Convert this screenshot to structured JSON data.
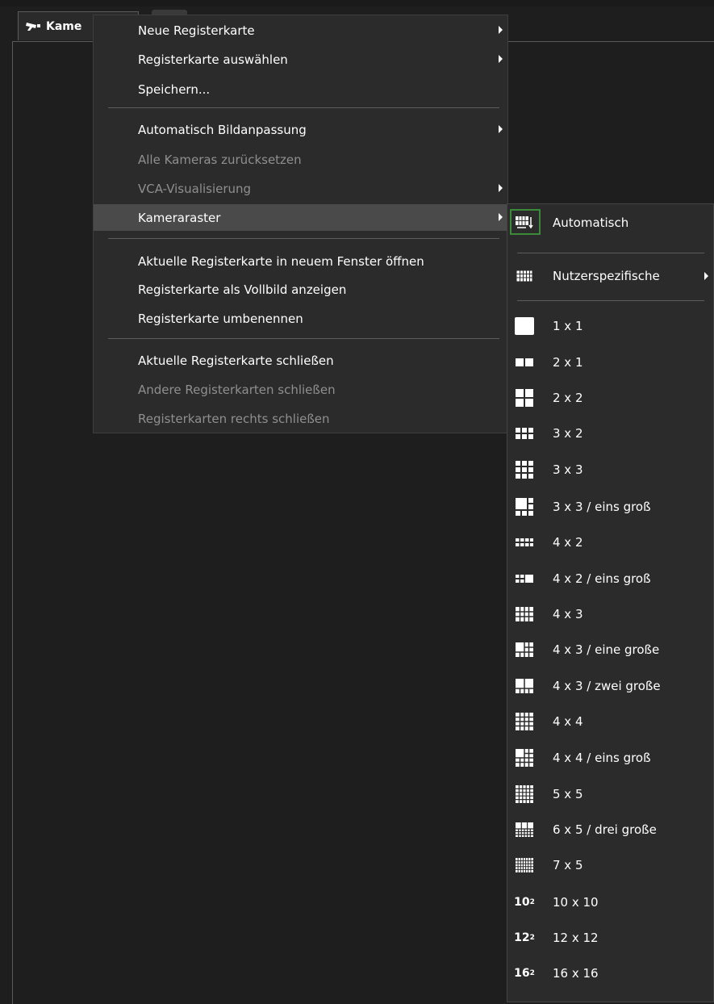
{
  "tab": {
    "label": "Kame"
  },
  "menu": {
    "items": [
      {
        "label": "Neue Registerkarte",
        "submenu": true,
        "disabled": false
      },
      {
        "label": "Registerkarte auswählen",
        "submenu": true,
        "disabled": false
      },
      {
        "label": "Speichern...",
        "submenu": false,
        "disabled": false
      },
      {
        "label": "Automatisch Bildanpassung",
        "submenu": true,
        "disabled": false
      },
      {
        "label": "Alle Kameras zurücksetzen",
        "submenu": false,
        "disabled": true
      },
      {
        "label": "VCA-Visualisierung",
        "submenu": true,
        "disabled": true
      },
      {
        "label": "Kameraraster",
        "submenu": true,
        "disabled": false,
        "highlighted": true
      },
      {
        "label": "Aktuelle Registerkarte in neuem Fenster öffnen",
        "submenu": false,
        "disabled": false
      },
      {
        "label": "Registerkarte als Vollbild anzeigen",
        "submenu": false,
        "disabled": false
      },
      {
        "label": "Registerkarte umbenennen",
        "submenu": false,
        "disabled": false
      },
      {
        "label": "Aktuelle Registerkarte schließen",
        "submenu": false,
        "disabled": false
      },
      {
        "label": "Andere Registerkarten schließen",
        "submenu": false,
        "disabled": true
      },
      {
        "label": "Registerkarten rechts schließen",
        "submenu": false,
        "disabled": true
      }
    ]
  },
  "submenu": {
    "automatic": {
      "label": "Automatisch",
      "icon": "auto-grid-icon"
    },
    "custom": {
      "label": "Nutzerspezifische",
      "icon": "custom-grid-icon"
    },
    "layouts": [
      {
        "label": "1 x 1",
        "icon": "grid-1x1-icon"
      },
      {
        "label": "2 x 1",
        "icon": "grid-2x1-icon"
      },
      {
        "label": "2 x 2",
        "icon": "grid-2x2-icon"
      },
      {
        "label": "3 x 2",
        "icon": "grid-3x2-icon"
      },
      {
        "label": "3 x 3",
        "icon": "grid-3x3-icon"
      },
      {
        "label": "3 x 3 / eins groß",
        "icon": "grid-3x3-one-large-icon"
      },
      {
        "label": "4 x 2",
        "icon": "grid-4x2-icon"
      },
      {
        "label": "4 x 2 / eins groß",
        "icon": "grid-4x2-one-large-icon"
      },
      {
        "label": "4 x 3",
        "icon": "grid-4x3-icon"
      },
      {
        "label": "4 x 3 / eine große",
        "icon": "grid-4x3-one-large-icon"
      },
      {
        "label": "4 x 3 / zwei große",
        "icon": "grid-4x3-two-large-icon"
      },
      {
        "label": "4 x 4",
        "icon": "grid-4x4-icon"
      },
      {
        "label": "4 x 4 / eins groß",
        "icon": "grid-4x4-one-large-icon"
      },
      {
        "label": "5 x 5",
        "icon": "grid-5x5-icon"
      },
      {
        "label": "6 x 5 / drei große",
        "icon": "grid-6x5-three-large-icon"
      },
      {
        "label": "7 x 5",
        "icon": "grid-7x5-icon"
      },
      {
        "label": "10 x 10",
        "icon": "grid-10x10-icon",
        "badge": "10",
        "badge_sup": "2"
      },
      {
        "label": "12 x 12",
        "icon": "grid-12x12-icon",
        "badge": "12",
        "badge_sup": "2"
      },
      {
        "label": "16 x 16",
        "icon": "grid-16x16-icon",
        "badge": "16",
        "badge_sup": "2"
      }
    ]
  }
}
